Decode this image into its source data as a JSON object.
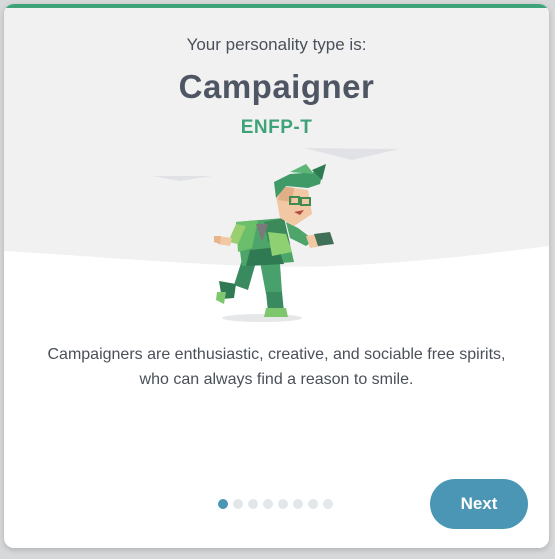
{
  "header": {
    "intro": "Your personality type is:",
    "type_name": "Campaigner",
    "type_code": "ENFP-T"
  },
  "illustration": {
    "icon": "campaigner-character-icon"
  },
  "description": "Campaigners are enthusiastic, creative, and sociable free spirits, who can always find a reason to smile.",
  "pagination": {
    "total": 8,
    "active_index": 0
  },
  "actions": {
    "next_label": "Next"
  },
  "colors": {
    "accent_green": "#3fa37a",
    "button_blue": "#4a96b4",
    "title_gray": "#4e5563"
  }
}
